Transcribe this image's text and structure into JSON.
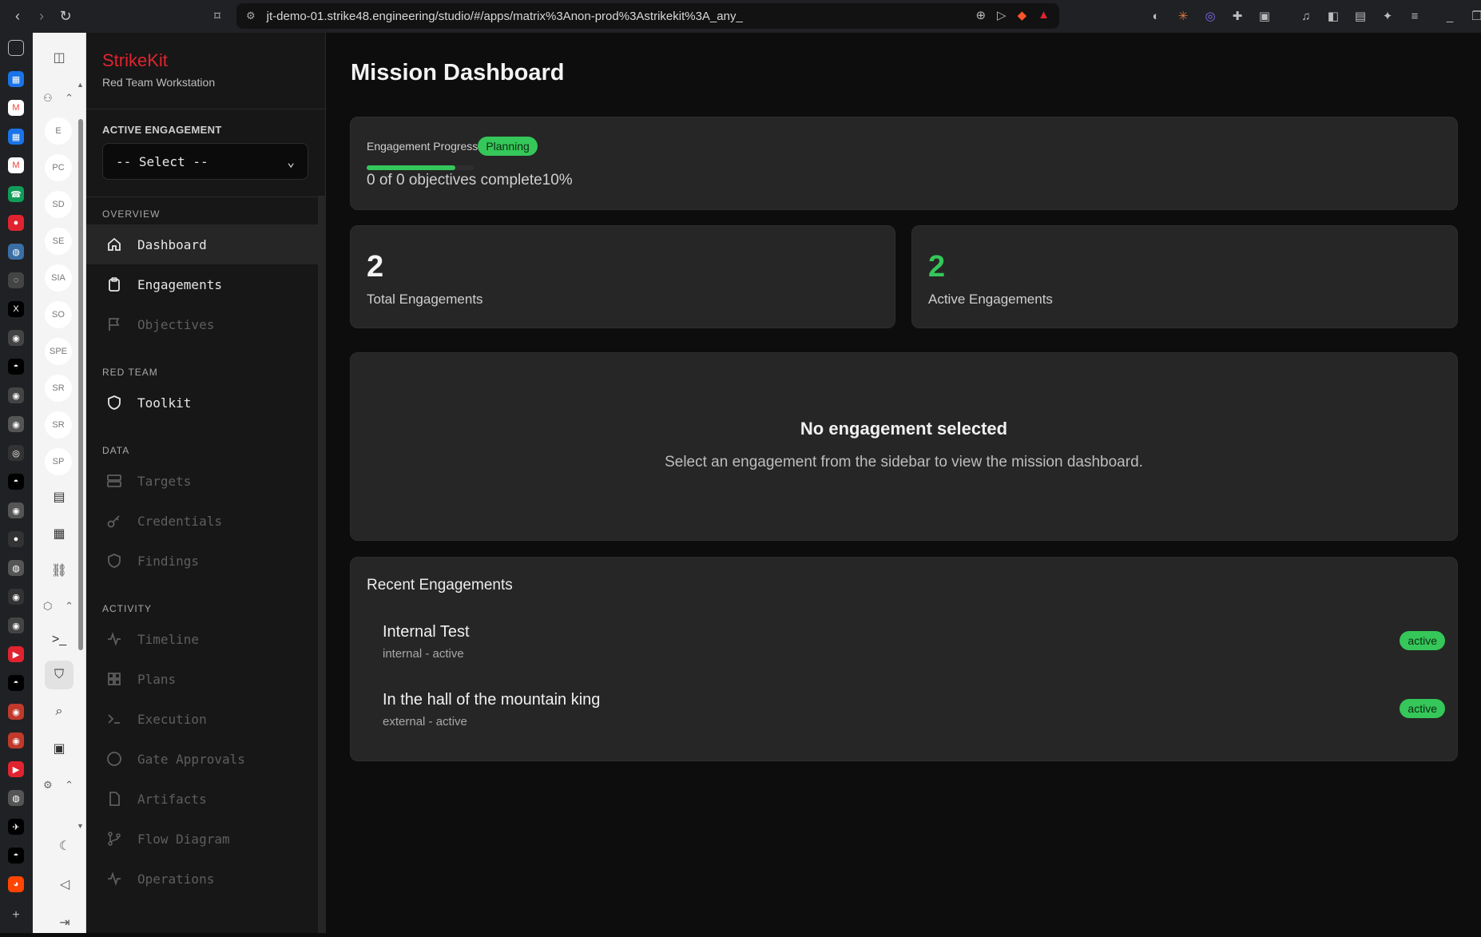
{
  "browser": {
    "url": "jt-demo-01.strike48.engineering/studio/#/apps/matrix%3Anon-prod%3Astrikekit%3A_any_"
  },
  "rail": {
    "avatars": [
      "E",
      "PC",
      "SD",
      "SE",
      "SIA",
      "SO",
      "SPE",
      "SR",
      "SR",
      "SP"
    ]
  },
  "sidebar": {
    "brand": "StrikeKit",
    "subtitle": "Red Team Workstation",
    "engagement_label": "ACTIVE ENGAGEMENT",
    "select_value": "-- Select --",
    "sections": {
      "overview": "OVERVIEW",
      "redteam": "RED TEAM",
      "data": "DATA",
      "activity": "ACTIVITY"
    },
    "items": {
      "dashboard": "Dashboard",
      "engagements": "Engagements",
      "objectives": "Objectives",
      "toolkit": "Toolkit",
      "targets": "Targets",
      "credentials": "Credentials",
      "findings": "Findings",
      "timeline": "Timeline",
      "plans": "Plans",
      "execution": "Execution",
      "gate_approvals": "Gate Approvals",
      "artifacts": "Artifacts",
      "flow_diagram": "Flow Diagram",
      "operations": "Operations"
    }
  },
  "main": {
    "title": "Mission Dashboard",
    "progress": {
      "label": "Engagement Progress",
      "status": "Planning",
      "text": "0 of 0 objectives complete10%",
      "fill_fraction": 0.1
    },
    "stats": [
      {
        "value": "2",
        "label": "Total Engagements",
        "color": "#f3f3f3"
      },
      {
        "value": "2",
        "label": "Active Engagements",
        "color": "#35c759"
      }
    ],
    "empty": {
      "title": "No engagement selected",
      "subtitle": "Select an engagement from the sidebar to view the mission dashboard."
    },
    "recent": {
      "title": "Recent Engagements",
      "rows": [
        {
          "name": "Internal Test",
          "meta": "internal - active",
          "badge": "active"
        },
        {
          "name": "In the hall of the mountain king",
          "meta": "external - active",
          "badge": "active"
        }
      ]
    }
  },
  "colors": {
    "accent": "#35c759",
    "brand": "#e0242f"
  }
}
